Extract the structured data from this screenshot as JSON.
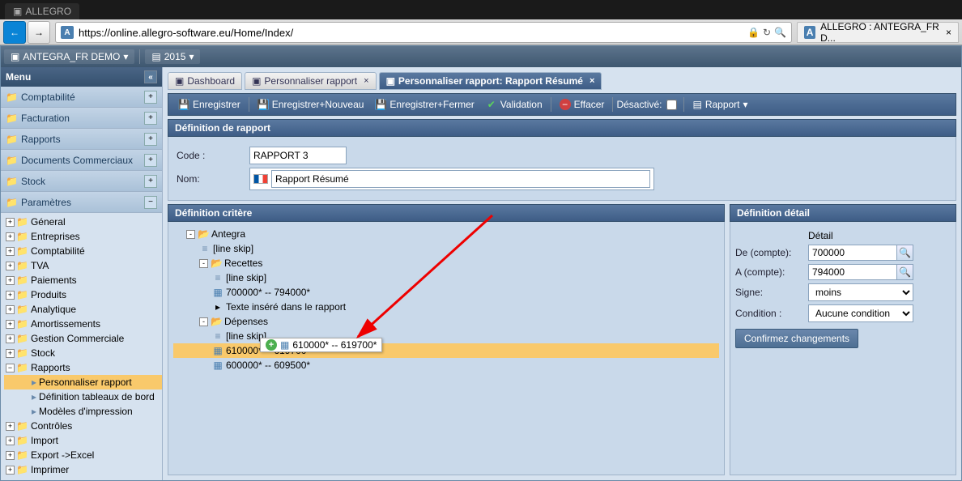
{
  "browser": {
    "dark_tab": "ALLEGRO",
    "url": "https://online.allegro-software.eu/Home/Index/",
    "tab_title": "ALLEGRO : ANTEGRA_FR D..."
  },
  "topbar": {
    "company": "ANTEGRA_FR DEMO",
    "year": "2015"
  },
  "sidebar": {
    "menu_title": "Menu",
    "sections": [
      "Comptabilité",
      "Facturation",
      "Rapports",
      "Documents Commerciaux",
      "Stock",
      "Paramètres"
    ],
    "tree": [
      {
        "label": "Géneral"
      },
      {
        "label": "Entreprises"
      },
      {
        "label": "Comptabilité"
      },
      {
        "label": "TVA"
      },
      {
        "label": "Paiements"
      },
      {
        "label": "Produits"
      },
      {
        "label": "Analytique"
      },
      {
        "label": "Amortissements"
      },
      {
        "label": "Gestion Commerciale"
      },
      {
        "label": "Stock"
      },
      {
        "label": "Rapports",
        "expanded": true,
        "children": [
          {
            "label": "Personnaliser rapport",
            "selected": true,
            "icon": "doc"
          },
          {
            "label": "Définition tableaux de bord",
            "icon": "doc"
          },
          {
            "label": "Modèles d'impression",
            "icon": "doc"
          }
        ]
      },
      {
        "label": "Contrôles"
      },
      {
        "label": "Import"
      },
      {
        "label": "Export ->Excel"
      },
      {
        "label": "Imprimer"
      }
    ]
  },
  "tabs": [
    "Dashboard",
    "Personnaliser rapport",
    "Personnaliser rapport: Rapport Résumé"
  ],
  "toolbar": {
    "save": "Enregistrer",
    "save_new": "Enregistrer+Nouveau",
    "save_close": "Enregistrer+Fermer",
    "validate": "Validation",
    "delete": "Effacer",
    "disabled_label": "Désactivé:",
    "report": "Rapport"
  },
  "definition": {
    "header": "Définition de rapport",
    "code_label": "Code :",
    "code_value": "RAPPORT 3",
    "name_label": "Nom:",
    "name_value": "Rapport Résumé"
  },
  "criteria": {
    "header": "Définition critère",
    "tree": [
      {
        "label": "Antegra",
        "type": "folder",
        "level": 0,
        "exp": "-"
      },
      {
        "label": "[line skip]",
        "type": "lineskip",
        "level": 1
      },
      {
        "label": "Recettes",
        "type": "folder",
        "level": 1,
        "exp": "-"
      },
      {
        "label": "[line skip]",
        "type": "lineskip",
        "level": 2
      },
      {
        "label": "700000* -- 794000*",
        "type": "range",
        "level": 2
      },
      {
        "label": "Texte inséré dans le rapport",
        "type": "text",
        "level": 2
      },
      {
        "label": "Dépenses",
        "type": "folder",
        "level": 1,
        "exp": "-"
      },
      {
        "label": "[line skip]",
        "type": "lineskip",
        "level": 2
      },
      {
        "label": "610000* -- 619700*",
        "type": "range",
        "level": 2,
        "selected": true
      },
      {
        "label": "600000* -- 609500*",
        "type": "range",
        "level": 2
      }
    ],
    "drag_ghost": "610000* -- 619700*"
  },
  "detail": {
    "header": "Définition détail",
    "detail_label": "Détail",
    "from_label": "De (compte):",
    "from_value": "700000",
    "to_label": "A (compte):",
    "to_value": "794000",
    "sign_label": "Signe:",
    "sign_value": "moins",
    "cond_label": "Condition :",
    "cond_value": "Aucune condition",
    "confirm": "Confirmez changements"
  }
}
